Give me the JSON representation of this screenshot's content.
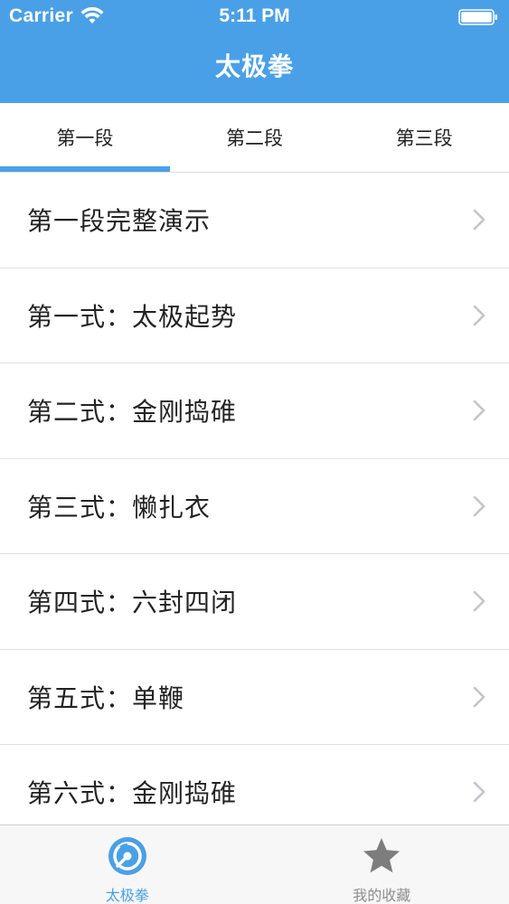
{
  "status_bar": {
    "carrier": "Carrier",
    "time": "5:11 PM"
  },
  "nav": {
    "title": "太极拳"
  },
  "segments": [
    {
      "label": "第一段",
      "selected": true
    },
    {
      "label": "第二段",
      "selected": false
    },
    {
      "label": "第三段",
      "selected": false
    }
  ],
  "list": {
    "items": [
      {
        "label": "第一段完整演示"
      },
      {
        "label": "第一式：太极起势"
      },
      {
        "label": "第二式：金刚捣碓"
      },
      {
        "label": "第三式：懒扎衣"
      },
      {
        "label": "第四式：六封四闭"
      },
      {
        "label": "第五式：单鞭"
      },
      {
        "label": "第六式：金刚捣碓"
      }
    ]
  },
  "tabbar": {
    "items": [
      {
        "label": "太极拳",
        "icon": "disc-icon",
        "selected": true
      },
      {
        "label": "我的收藏",
        "icon": "star-icon",
        "selected": false
      }
    ]
  },
  "colors": {
    "accent": "#4aa0e6",
    "tab_inactive": "#8e8e8e",
    "star_inactive": "#7d7d7d"
  }
}
